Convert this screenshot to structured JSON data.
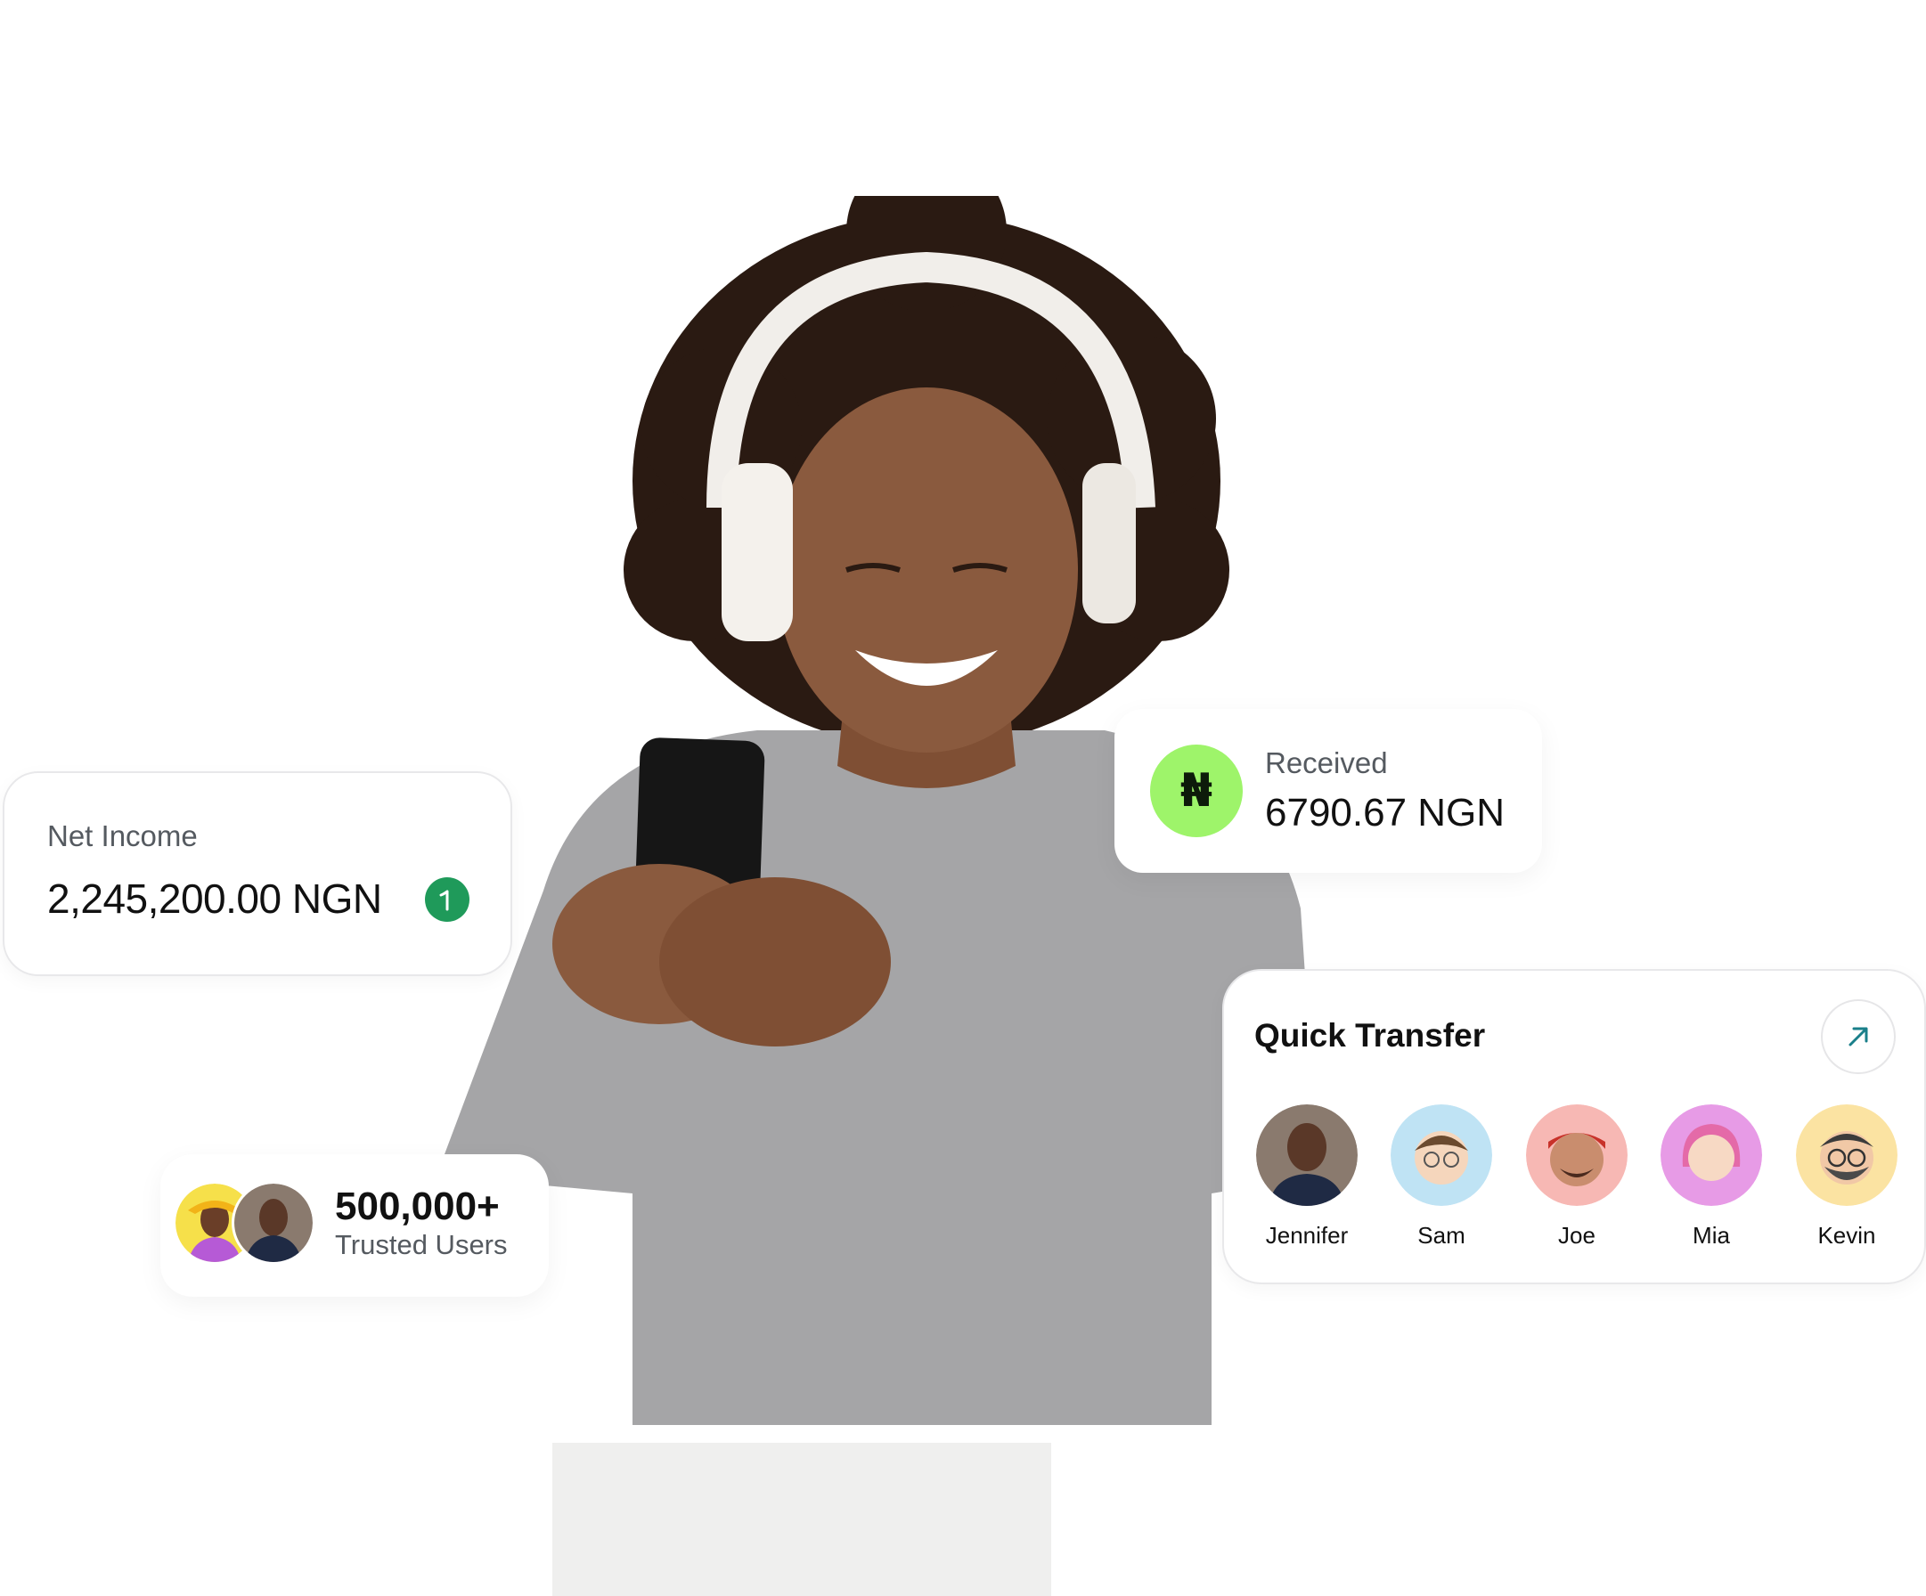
{
  "net_income": {
    "label": "Net Income",
    "value": "2,245,200.00 NGN",
    "trend_icon": "arrow-up-icon",
    "trend_color": "#1f9a5a"
  },
  "received": {
    "label": "Received",
    "value": "6790.67 NGN",
    "icon": "naira-icon",
    "icon_glyph": "₦",
    "icon_bg": "#9ef46a"
  },
  "quick_transfer": {
    "title": "Quick Transfer",
    "expand_icon": "arrow-up-right-icon",
    "accent": "#1a7f8a",
    "contacts": [
      {
        "name": "Jennifer",
        "avatar_bg": "#8a7a6e"
      },
      {
        "name": "Sam",
        "avatar_bg": "#bfe3f4"
      },
      {
        "name": "Joe",
        "avatar_bg": "#f7b8b4"
      },
      {
        "name": "Mia",
        "avatar_bg": "#e79be6"
      },
      {
        "name": "Kevin",
        "avatar_bg": "#fbe3a2"
      }
    ]
  },
  "trusted_users": {
    "count": "500,000+",
    "label": "Trusted Users"
  },
  "hero": {
    "shirt_color": "#a5a5a7",
    "skin_color": "#8a5a3e",
    "hair_color": "#2a1a12"
  }
}
